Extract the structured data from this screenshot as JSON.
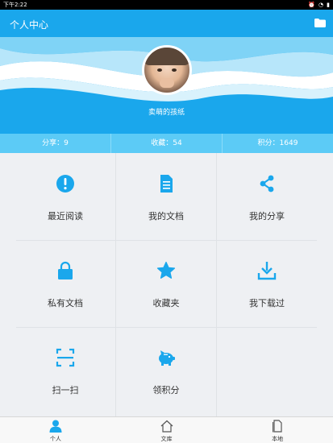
{
  "status": {
    "time": "下午2:22"
  },
  "app_bar": {
    "title": "个人中心"
  },
  "profile": {
    "username": "卖萌的孩纸"
  },
  "stats": [
    {
      "label": "分享：9"
    },
    {
      "label": "收藏：54"
    },
    {
      "label": "积分：1649"
    }
  ],
  "menu": [
    {
      "label": "最近阅读",
      "icon": "alert-icon"
    },
    {
      "label": "我的文档",
      "icon": "document-icon"
    },
    {
      "label": "我的分享",
      "icon": "share-icon"
    },
    {
      "label": "私有文档",
      "icon": "lock-icon"
    },
    {
      "label": "收藏夹",
      "icon": "star-icon"
    },
    {
      "label": "我下载过",
      "icon": "download-icon"
    },
    {
      "label": "扫一扫",
      "icon": "scan-icon"
    },
    {
      "label": "领积分",
      "icon": "piggy-bank-icon"
    }
  ],
  "tabs": [
    {
      "label": "个人",
      "icon": "person-icon",
      "active": true
    },
    {
      "label": "文库",
      "icon": "house-icon",
      "active": false
    },
    {
      "label": "本地",
      "icon": "file-icon",
      "active": false
    }
  ],
  "colors": {
    "accent": "#1aa7ec",
    "stats_bar": "#5ccbf6",
    "background": "#eef0f3"
  }
}
